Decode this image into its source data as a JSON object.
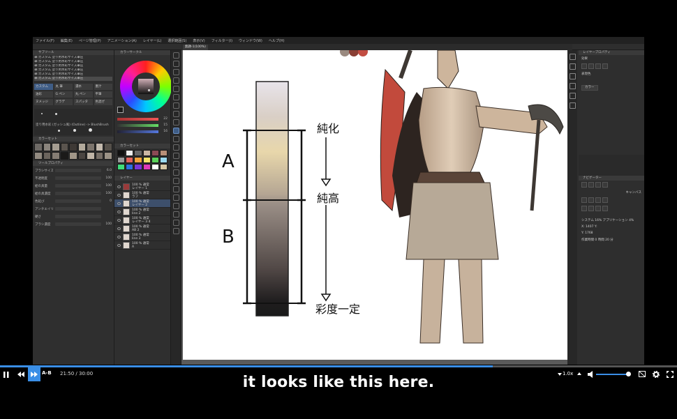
{
  "app": {
    "menu": [
      "ファイル(F)",
      "編集(E)",
      "ページ管理(P)",
      "アニメーション(A)",
      "レイヤー(L)",
      "選択範囲(S)",
      "表示(V)",
      "フィルター(I)",
      "ウィンドウ(W)",
      "ヘルプ(H)"
    ],
    "canvas_tab": "無題-1(100%)"
  },
  "subtool_list": [
    "筆:カスタム 塗り用水彩サイズ筆圧",
    "筆:カスタム 塗り用水彩サイズ筆圧",
    "筆:カスタム 塗り用水彩サイズ筆圧",
    "筆:カスタム 塗り用水彩サイズ筆圧",
    "筆:カスタム 塗り用水彩サイズ筆圧",
    "筆:カスタム 塗り用水彩サイズ筆圧"
  ],
  "brushes": [
    "カスタム",
    "丸 筆",
    "濃水",
    "墨汁",
    "油彩",
    "G ペン",
    "丸 ペン",
    "平筆",
    "ヌメッジ",
    "グラデ",
    "スパッタ",
    "色混ぜ"
  ],
  "brush_preview_name": "塗り用水彩 (ガッシュ風) (Outline) -> BlushBrush",
  "tool_props": [
    {
      "label": "ブラシサイズ",
      "value": "6.0"
    },
    {
      "label": "不透明度",
      "value": "100"
    },
    {
      "label": "絵の具量",
      "value": "100"
    },
    {
      "label": "絵の具濃度",
      "value": "100"
    },
    {
      "label": "色延び",
      "value": "0"
    },
    {
      "label": "アンチエイリアス",
      "value": ""
    },
    {
      "label": "硬さ",
      "value": ""
    },
    {
      "label": "ブラシ濃度",
      "value": "100"
    }
  ],
  "color_values": {
    "h": "22",
    "s": "15",
    "v": "16"
  },
  "layers": [
    {
      "blend": "100 % 通常",
      "name": "レイヤー 1",
      "selected": false
    },
    {
      "blend": "100 % 通常",
      "name": "ラフ",
      "selected": false
    },
    {
      "blend": "100 % 通常",
      "name": "レイヤー 2",
      "selected": true
    },
    {
      "blend": "100 % 通常",
      "name": "line 2",
      "selected": false
    },
    {
      "blend": "100 % 通常",
      "name": "レイヤー 3 4",
      "selected": false
    },
    {
      "blend": "100 % 通常",
      "name": "AB 2",
      "selected": false
    },
    {
      "blend": "100 % 通常",
      "name": "line 3",
      "selected": false
    },
    {
      "blend": "100 % 通常",
      "name": "A",
      "selected": false
    }
  ],
  "drawing": {
    "label_a": "A",
    "label_b": "B",
    "note_top": "純化",
    "note_mid": "純高",
    "note_bottom": "彩度一定"
  },
  "right_panel": {
    "title": "レイヤープロパティ",
    "effect": "効果",
    "expression_color": "表現色",
    "color_value": "カラー",
    "panel2_title": "ナビゲーター",
    "canvas_label": "キャンバス",
    "info_rows": [
      "システム 16%  アプリケーション 4%",
      "X: 1407   Y:",
      "Y: 1768",
      "作業時間  0 時間 20 分"
    ]
  },
  "player": {
    "ab_label": "A-B",
    "current_time": "21:50",
    "total_time": "30:00",
    "progress": 0.728,
    "speed": "1.0x",
    "volume": 0.9
  },
  "subtitle": "it looks like this here."
}
